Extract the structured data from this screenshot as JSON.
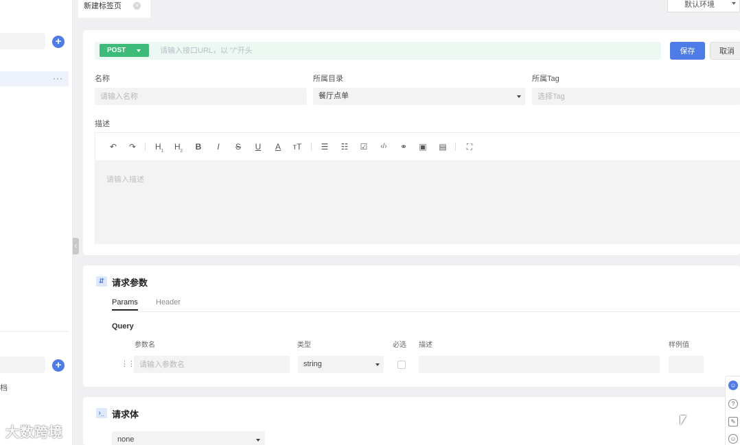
{
  "tabs": [
    {
      "label": "新建标签页"
    }
  ],
  "environment": {
    "selected": "默认环境"
  },
  "sidebar": {
    "doc_text": "档"
  },
  "request": {
    "method": "POST",
    "url_placeholder": "请输入接口URL，以 \"/\"开头",
    "save_label": "保存",
    "cancel_label": "取消"
  },
  "form": {
    "name_label": "名称",
    "name_placeholder": "请输入名称",
    "dir_label": "所属目录",
    "dir_value": "餐厅点单",
    "tag_label": "所属Tag",
    "tag_placeholder": "选择Tag",
    "desc_label": "描述",
    "desc_placeholder": "请输入描述"
  },
  "editor_toolbar": {
    "heading1": "H",
    "heading2": "H",
    "bold": "B",
    "italic": "I",
    "strike": "S",
    "underline": "U",
    "font_color": "A",
    "font_size": "тT"
  },
  "params_section": {
    "title": "请求参数",
    "tabs": [
      {
        "label": "Params"
      },
      {
        "label": "Header"
      }
    ],
    "query_label": "Query",
    "columns": {
      "name": "参数名",
      "type": "类型",
      "required": "必选",
      "desc": "描述",
      "example": "样例值"
    },
    "row": {
      "name_placeholder": "请输入参数名",
      "type_value": "string"
    }
  },
  "body_section": {
    "title": "请求体",
    "type_value": "none"
  },
  "watermark": "大数跨境",
  "colors": {
    "accent": "#4d7ce8",
    "method_post": "#3cbb79",
    "url_bg": "#edf8f3"
  }
}
